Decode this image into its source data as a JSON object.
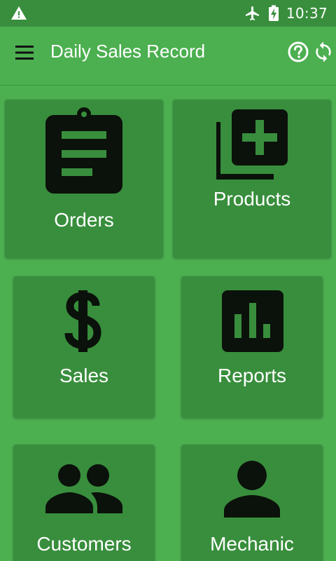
{
  "status_bar": {
    "time": "10:37",
    "icons": [
      "warning-icon",
      "airplane-mode-icon",
      "battery-charging-icon"
    ]
  },
  "app_bar": {
    "title": "Daily Sales Record",
    "menu_icon": "menu-icon",
    "help_icon": "help-icon",
    "sync_icon": "sync-icon"
  },
  "tiles": [
    {
      "label": "Orders",
      "icon": "clipboard-icon"
    },
    {
      "label": "Products",
      "icon": "add-to-library-icon"
    },
    {
      "label": "Sales",
      "icon": "dollar-icon"
    },
    {
      "label": "Reports",
      "icon": "bar-chart-icon"
    },
    {
      "label": "Customers",
      "icon": "people-icon"
    },
    {
      "label": "Mechanic",
      "icon": "person-icon"
    }
  ],
  "colors": {
    "background": "#4caf50",
    "status_bar": "#388e3c",
    "tile": "#388e3c",
    "icon": "#0b110b",
    "text": "#ffffff"
  }
}
